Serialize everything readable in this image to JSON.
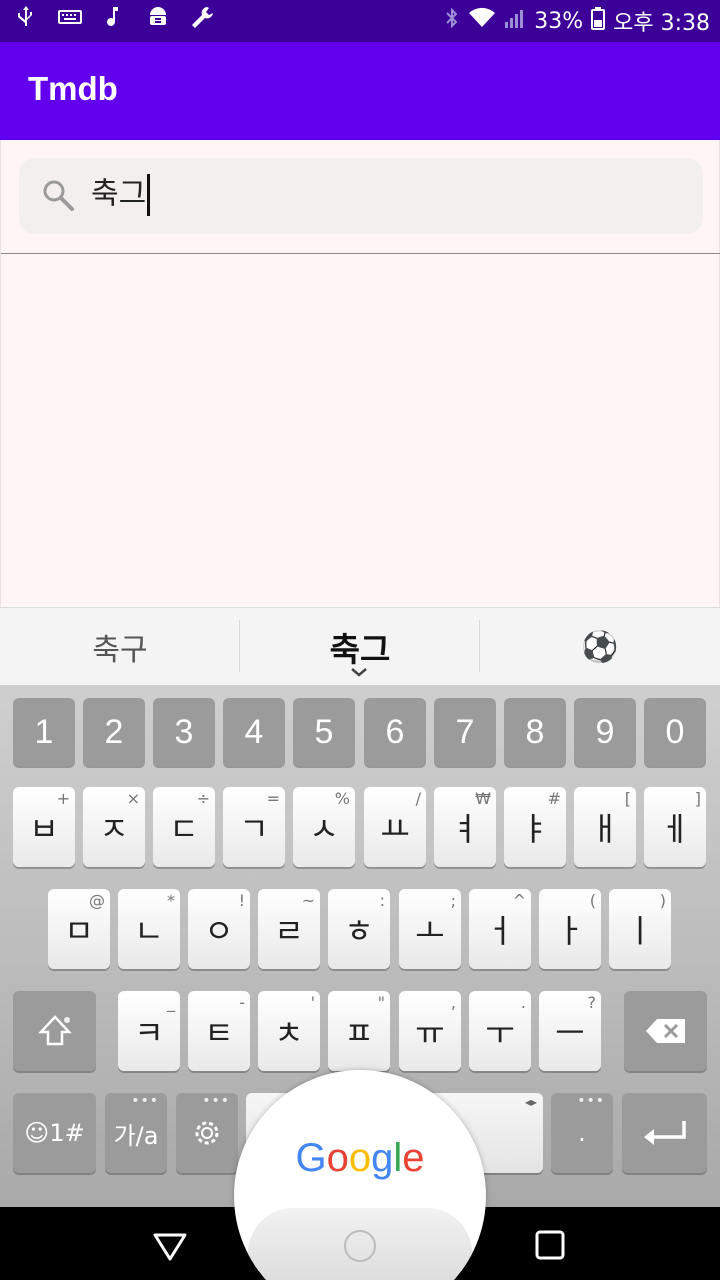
{
  "status_bar": {
    "left_icons": [
      "usb-icon",
      "keyboard-icon",
      "music-note-icon",
      "android-debug-icon",
      "wrench-icon"
    ],
    "right_icons": [
      "bluetooth-icon",
      "wifi-icon",
      "signal-icon",
      "battery-icon"
    ],
    "battery": "33%",
    "time": "오후 3:38"
  },
  "app_bar": {
    "title": "Tmdb"
  },
  "search": {
    "query": "축그",
    "icon": "search-icon"
  },
  "suggestions": {
    "items": [
      "축구",
      "축그",
      "⚽"
    ]
  },
  "keyboard": {
    "number_row": [
      "1",
      "2",
      "3",
      "4",
      "5",
      "6",
      "7",
      "8",
      "9",
      "0"
    ],
    "row1": [
      {
        "key": "ㅂ",
        "hint": "+"
      },
      {
        "key": "ㅈ",
        "hint": "×"
      },
      {
        "key": "ㄷ",
        "hint": "÷"
      },
      {
        "key": "ㄱ",
        "hint": "="
      },
      {
        "key": "ㅅ",
        "hint": "%"
      },
      {
        "key": "ㅛ",
        "hint": "/"
      },
      {
        "key": "ㅕ",
        "hint": "₩"
      },
      {
        "key": "ㅑ",
        "hint": "#"
      },
      {
        "key": "ㅐ",
        "hint": "["
      },
      {
        "key": "ㅔ",
        "hint": "]"
      }
    ],
    "row2": [
      {
        "key": "ㅁ",
        "hint": "@"
      },
      {
        "key": "ㄴ",
        "hint": "*"
      },
      {
        "key": "ㅇ",
        "hint": "!"
      },
      {
        "key": "ㄹ",
        "hint": "~"
      },
      {
        "key": "ㅎ",
        "hint": ":"
      },
      {
        "key": "ㅗ",
        "hint": ";"
      },
      {
        "key": "ㅓ",
        "hint": "^"
      },
      {
        "key": "ㅏ",
        "hint": "("
      },
      {
        "key": "ㅣ",
        "hint": ")"
      }
    ],
    "row3": [
      {
        "key": "ㅋ",
        "hint": "_"
      },
      {
        "key": "ㅌ",
        "hint": "-"
      },
      {
        "key": "ㅊ",
        "hint": "'"
      },
      {
        "key": "ㅍ",
        "hint": "\""
      },
      {
        "key": "ㅠ",
        "hint": ","
      },
      {
        "key": "ㅜ",
        "hint": "."
      },
      {
        "key": "ㅡ",
        "hint": "?"
      }
    ],
    "symbols_label": "☺1#",
    "lang_label": "가/a",
    "period_label": ".",
    "colors": {
      "number_key": "#9b9b9b",
      "letter_key": "#ffffff"
    }
  },
  "google": {
    "logo_text": [
      "G",
      "o",
      "o",
      "g",
      "l",
      "e"
    ],
    "logo_colors": [
      "#4285f4",
      "#ea4335",
      "#fbbc05",
      "#4285f4",
      "#34a853",
      "#ea4335"
    ]
  },
  "nav_bar": {
    "icons": [
      "back-icon",
      "home-icon",
      "recents-icon"
    ]
  },
  "colors": {
    "status_bar": "#3c0099",
    "app_bar": "#6200ee",
    "content_bg": "#fff5f4"
  }
}
